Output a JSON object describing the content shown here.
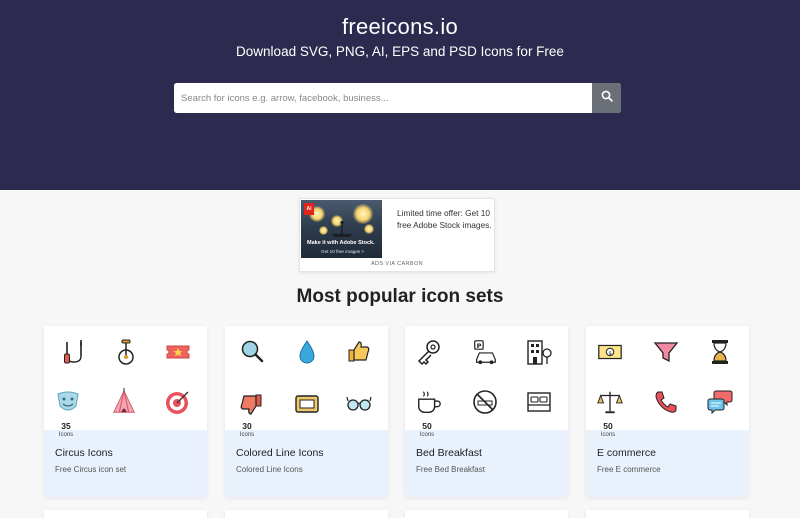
{
  "header": {
    "site_title": "freeicons.io",
    "tagline": "Download SVG, PNG, AI, EPS and PSD Icons for Free",
    "search": {
      "placeholder": "Search for icons e.g. arrow, facebook, business...",
      "value": "",
      "button_icon": "search-icon"
    }
  },
  "ad": {
    "image_caption": "Make it with Adobe Stock.",
    "image_subcaption": "Get 10 free images >",
    "brand_mark": "Ai",
    "text": "Limited time offer: Get 10 free Adobe Stock images.",
    "via": "ADS VIA CARBON"
  },
  "section": {
    "title": "Most popular icon sets"
  },
  "cards": [
    {
      "title": "Circus Icons",
      "count": "35",
      "count_label": "Icons",
      "desc": "Free Circus icon set",
      "icons": [
        "jump-rope-icon",
        "unicycle-icon",
        "ticket-icon",
        "theatre-mask-icon",
        "circus-tent-icon",
        "target-icon"
      ]
    },
    {
      "title": "Colored Line Icons",
      "count": "30",
      "count_label": "Icons",
      "desc": "Colored Line Icons",
      "icons": [
        "magnifier-icon",
        "water-drop-icon",
        "thumbs-up-icon",
        "thumbs-down-icon",
        "battery-icon",
        "glasses-icon"
      ]
    },
    {
      "title": "Bed Breakfast",
      "count": "50",
      "count_label": "Icons",
      "desc": "Free Bed Breakfast",
      "icons": [
        "key-tag-icon",
        "parking-icon",
        "hotel-building-icon",
        "coffee-cup-icon",
        "no-smoking-icon",
        "bed-icon"
      ]
    },
    {
      "title": "E commerce",
      "count": "50",
      "count_label": "Icons",
      "desc": "Free E commerce",
      "icons": [
        "money-icon",
        "funnel-icon",
        "hourglass-icon",
        "scales-icon",
        "phone-icon",
        "chat-bubbles-icon"
      ]
    }
  ],
  "colors": {
    "hero_bg": "#2d2a4f",
    "band_bg": "#e9f2fc",
    "search_btn": "#6b6f77",
    "page_bg": "#f7f7f8"
  }
}
